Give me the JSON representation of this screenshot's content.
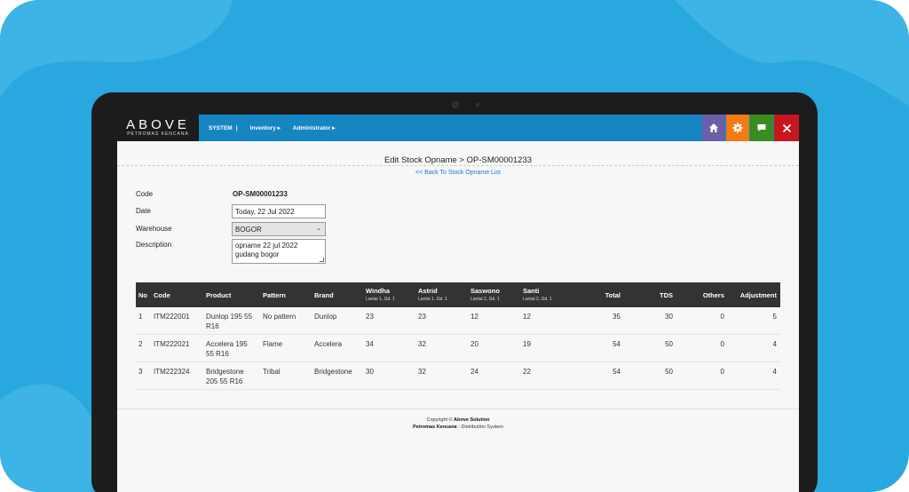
{
  "app": {
    "logo_main": "ABOVE",
    "logo_sub": "PETROMAS KENCANA",
    "nav": [
      "SYSTEM",
      "|",
      "Inventory ▸",
      "Administrator ▸"
    ]
  },
  "page": {
    "title": "Edit Stock Opname > OP-SM00001233",
    "back_link": "<< Back To Stock Opname List"
  },
  "form": {
    "code_label": "Code",
    "code_value": "OP-SM00001233",
    "date_label": "Date",
    "date_value": "Today, 22 Jul 2022",
    "warehouse_label": "Warehouse",
    "warehouse_value": "BOGOR",
    "description_label": "Description",
    "description_line1": "opname 22 jul 2022",
    "description_line2": "gudang bogor"
  },
  "table": {
    "headers": {
      "no": "No",
      "code": "Code",
      "product": "Product",
      "pattern": "Pattern",
      "brand": "Brand",
      "windha": "Windha",
      "windha_sub": "Lantai 1, Gd. 1",
      "astrid": "Astrid",
      "astrid_sub": "Lantai 1, Gd. 1",
      "saswono": "Saswono",
      "saswono_sub": "Lantai 2, Gd. 1",
      "santi": "Santi",
      "santi_sub": "Lantai 2, Gd. 1",
      "total": "Total",
      "tds": "TDS",
      "others": "Others",
      "adjustment": "Adjustment"
    },
    "rows": [
      {
        "no": "1",
        "code": "ITM222001",
        "product1": "Dunlop 195 55",
        "product2": "R16",
        "pattern": "No pattern",
        "brand": "Dunlop",
        "windha": "23",
        "astrid": "23",
        "saswono": "12",
        "santi": "12",
        "total": "35",
        "tds": "30",
        "others": "0",
        "adjustment": "5"
      },
      {
        "no": "2",
        "code": "ITM222021",
        "product1": "Accelera 195",
        "product2": "55 R16",
        "pattern": "Flame",
        "brand": "Accelera",
        "windha": "34",
        "astrid": "32",
        "saswono": "20",
        "santi": "19",
        "total": "54",
        "tds": "50",
        "others": "0",
        "adjustment": "4"
      },
      {
        "no": "3",
        "code": "ITM222324",
        "product1": "Bridgestone",
        "product2": "205 55 R16",
        "pattern": "Tribal",
        "brand": "Bridgestone",
        "windha": "30",
        "astrid": "32",
        "saswono": "24",
        "santi": "22",
        "total": "54",
        "tds": "50",
        "others": "0",
        "adjustment": "4"
      }
    ]
  },
  "footer": {
    "copyright_prefix": "Copyright ©",
    "company": "Above Solution",
    "client": "Petromas Kencana",
    "suffix": "- Distribution System"
  },
  "icons": {
    "home": "home-icon",
    "settings": "gear-icon",
    "chat": "chat-icon",
    "close": "close-icon"
  },
  "colors": {
    "background": "#29a8e0",
    "topbar": "#1686c3",
    "home_button": "#6a5fa8",
    "settings_button": "#f07c12",
    "chat_button": "#3a8c1e",
    "close_button": "#c8161e"
  }
}
